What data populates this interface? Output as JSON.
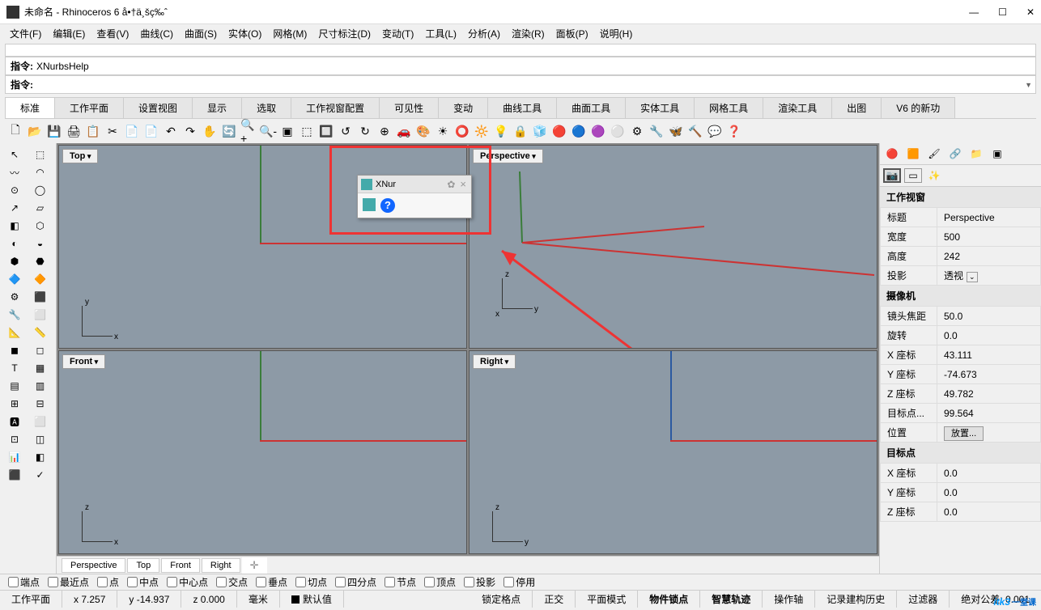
{
  "window": {
    "title": "未命名 - Rhinoceros 6 å•†ä¸šç‰ˆ"
  },
  "menus": [
    "文件(F)",
    "编辑(E)",
    "查看(V)",
    "曲线(C)",
    "曲面(S)",
    "实体(O)",
    "网格(M)",
    "尺寸标注(D)",
    "变动(T)",
    "工具(L)",
    "分析(A)",
    "渲染(R)",
    "面板(P)",
    "说明(H)"
  ],
  "command": {
    "history": "",
    "line1_label": "指令:",
    "line1_value": "XNurbsHelp",
    "line2_label": "指令:",
    "line2_value": ""
  },
  "tabs": [
    "标准",
    "工作平面",
    "设置视图",
    "显示",
    "选取",
    "工作视窗配置",
    "可见性",
    "变动",
    "曲线工具",
    "曲面工具",
    "实体工具",
    "网格工具",
    "渲染工具",
    "出图",
    "V6 的新功"
  ],
  "viewports": {
    "tl": "Top",
    "tr": "Perspective",
    "bl": "Front",
    "br": "Right"
  },
  "xnur": {
    "title": "XNur"
  },
  "vptabs": [
    "Perspective",
    "Top",
    "Front",
    "Right"
  ],
  "osnaps": [
    "端点",
    "最近点",
    "点",
    "中点",
    "中心点",
    "交点",
    "垂点",
    "切点",
    "四分点",
    "节点",
    "顶点",
    "投影",
    "停用"
  ],
  "props": {
    "viewportTitle": "工作视窗",
    "title_l": "标题",
    "title_v": "Perspective",
    "width_l": "宽度",
    "width_v": "500",
    "height_l": "高度",
    "height_v": "242",
    "proj_l": "投影",
    "proj_v": "透视",
    "cameraTitle": "摄像机",
    "focal_l": "镜头焦距",
    "focal_v": "50.0",
    "rot_l": "旋转",
    "rot_v": "0.0",
    "x_l": "X 座标",
    "x_v": "43.111",
    "y_l": "Y 座标",
    "y_v": "-74.673",
    "z_l": "Z 座标",
    "z_v": "49.782",
    "tgt_l": "目标点...",
    "tgt_v": "99.564",
    "loc_l": "位置",
    "loc_btn": "放置...",
    "targetTitle": "目标点",
    "tx_l": "X 座标",
    "tx_v": "0.0",
    "ty_l": "Y 座标",
    "ty_v": "0.0",
    "tz_l": "Z 座标",
    "tz_v": "0.0"
  },
  "status": {
    "cplane": "工作平面",
    "x": "x 7.257",
    "y": "y -14.937",
    "z": "z 0.000",
    "unit": "毫米",
    "layer": "默认值",
    "gridsnap": "锁定格点",
    "ortho": "正交",
    "planar": "平面模式",
    "osnap": "物件锁点",
    "smart": "智慧轨迹",
    "gumball": "操作轴",
    "record": "记录建构历史",
    "filter": "过滤器",
    "tol": "绝对公差: 0.001"
  },
  "watermark": {
    "text": "itk3",
    "sub": "一堂课"
  }
}
